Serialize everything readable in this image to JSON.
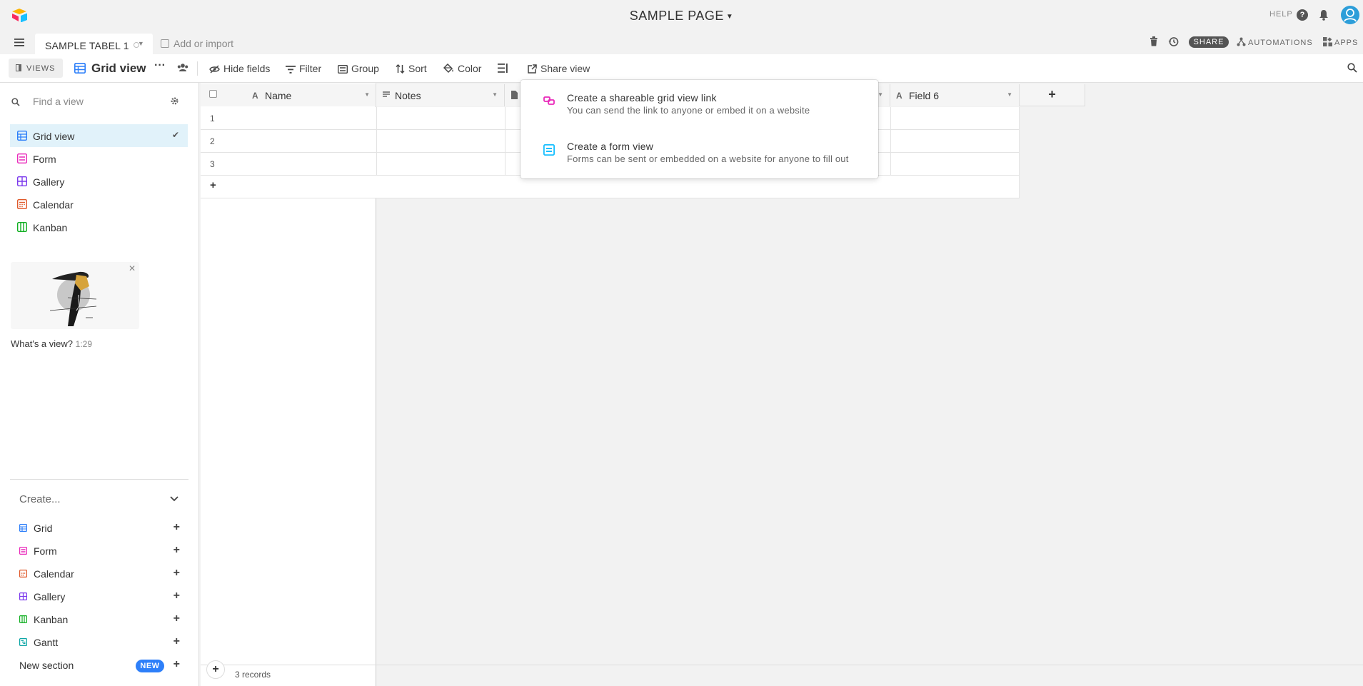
{
  "app": {
    "page_title": "SAMPLE PAGE",
    "help_label": "HELP",
    "help_q": "?"
  },
  "tabs": {
    "active_label": "SAMPLE TABEL 1",
    "add_import_label": "Add or import"
  },
  "header_tools": {
    "share_label": "SHARE",
    "automations_label": "AUTOMATIONS",
    "apps_label": "APPS"
  },
  "toolbar": {
    "views_label": "VIEWS",
    "current_view": "Grid view",
    "more": "···",
    "hide_fields": "Hide fields",
    "filter": "Filter",
    "group": "Group",
    "sort": "Sort",
    "color": "Color",
    "share_view": "Share view"
  },
  "sidebar": {
    "find_placeholder": "Find a view",
    "views": [
      {
        "label": "Grid view",
        "color": "#2d7ff9",
        "active": true
      },
      {
        "label": "Form",
        "color": "#e929ba"
      },
      {
        "label": "Gallery",
        "color": "#7c39ed"
      },
      {
        "label": "Calendar",
        "color": "#e0592a"
      },
      {
        "label": "Kanban",
        "color": "#11af22"
      }
    ],
    "video_label": "What's a view?",
    "video_duration": "1:29",
    "create_label": "Create...",
    "create_items": [
      {
        "label": "Grid",
        "color": "#2d7ff9"
      },
      {
        "label": "Form",
        "color": "#e929ba"
      },
      {
        "label": "Calendar",
        "color": "#e0592a"
      },
      {
        "label": "Gallery",
        "color": "#7c39ed"
      },
      {
        "label": "Kanban",
        "color": "#11af22"
      },
      {
        "label": "Gantt",
        "color": "#0ba5a5"
      }
    ],
    "new_section_label": "New section",
    "new_badge": "NEW",
    "plus": "+"
  },
  "grid": {
    "columns": [
      "Name",
      "Notes",
      "",
      "Field 6"
    ],
    "rows": [
      "1",
      "2",
      "3"
    ],
    "add_row": "+",
    "add_col": "+",
    "records_label": "3 records",
    "field_type_glyph": "A"
  },
  "share_popup": {
    "items": [
      {
        "title": "Create a shareable grid view link",
        "desc": "You can send the link to anyone or embed it on a website",
        "icon_color": "#e929ba"
      },
      {
        "title": "Create a form view",
        "desc": "Forms can be sent or embedded on a website for anyone to fill out",
        "icon_color": "#18bfff"
      }
    ]
  }
}
